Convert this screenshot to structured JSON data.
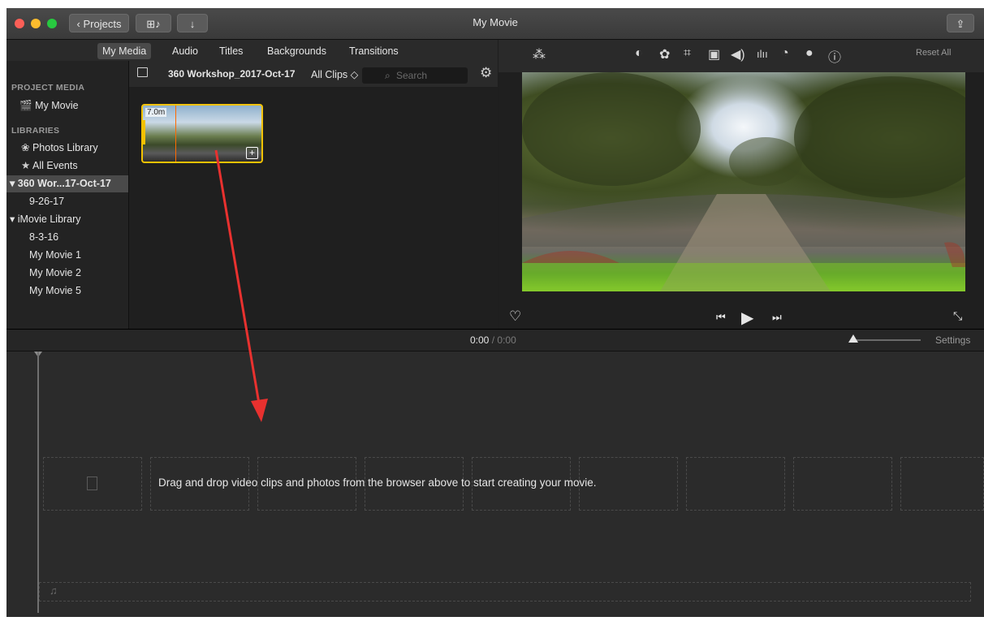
{
  "window": {
    "title": "My Movie",
    "projects_button": "Projects",
    "back_glyph": "‹",
    "import_glyph": "↓",
    "share_glyph": "⇪",
    "media_glyph": "⊞♪"
  },
  "tabs": [
    "My Media",
    "Audio",
    "Titles",
    "Backgrounds",
    "Transitions"
  ],
  "sidebar": {
    "project_media_header": "PROJECT MEDIA",
    "project_item": "My Movie",
    "libraries_header": "LIBRARIES",
    "items": [
      {
        "label": "Photos Library",
        "indent": 1,
        "selected": false
      },
      {
        "label": "All Events",
        "indent": 1,
        "selected": false
      },
      {
        "label": "▾ 360 Wor...17-Oct-17",
        "indent": 0,
        "selected": true
      },
      {
        "label": "9-26-17",
        "indent": 2,
        "selected": false
      },
      {
        "label": "▾ iMovie Library",
        "indent": 0,
        "selected": false
      },
      {
        "label": "8-3-16",
        "indent": 2,
        "selected": false
      },
      {
        "label": "My Movie 1",
        "indent": 2,
        "selected": false
      },
      {
        "label": "My Movie 2",
        "indent": 2,
        "selected": false
      },
      {
        "label": "My Movie 5",
        "indent": 2,
        "selected": false
      }
    ]
  },
  "browser": {
    "event_title": "360 Workshop_2017-Oct-17",
    "filter_label": "All Clips ◇",
    "search_placeholder": "Search",
    "clip": {
      "duration": "7.0m"
    }
  },
  "viewer": {
    "reset_label": "Reset All",
    "tool_icons": [
      "magic-wand-icon",
      "color-balance-icon",
      "color-palette-icon",
      "crop-icon",
      "stabilization-icon",
      "volume-icon",
      "equalizer-icon",
      "speed-icon",
      "filter-icon",
      "info-icon"
    ]
  },
  "timeline": {
    "time_current": "0:00",
    "time_separator": "/",
    "time_total": "0:00",
    "settings_label": "Settings",
    "drop_message": "Drag and drop video clips and photos from the browser above to start creating your movie."
  },
  "colors": {
    "clip_border": "#f2c200",
    "arrow": "#e8312f",
    "close": "#fc5f57",
    "minimize": "#fdbc2e",
    "zoom": "#28c840"
  }
}
